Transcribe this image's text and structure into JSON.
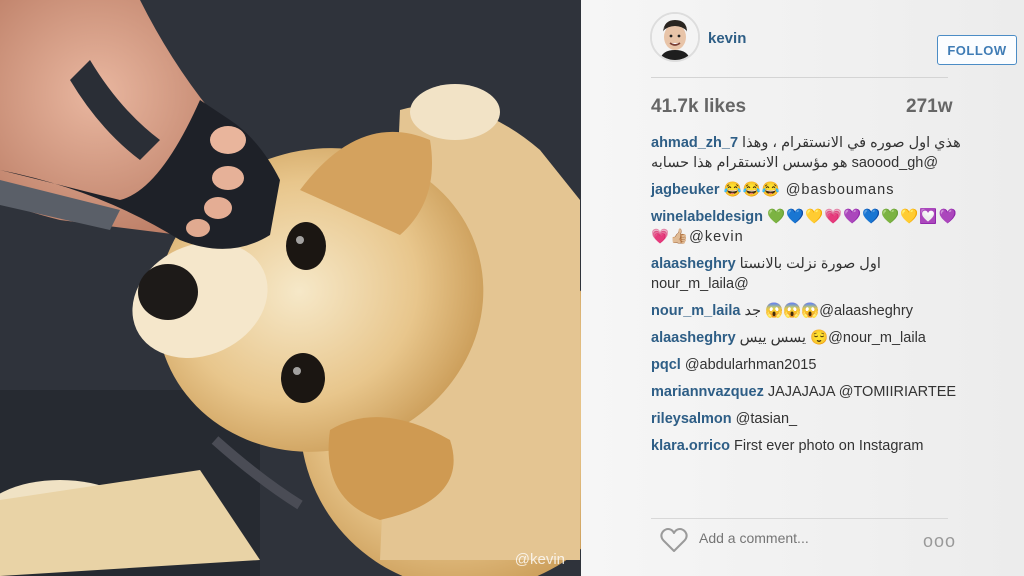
{
  "photo": {
    "watermark": "@kevin"
  },
  "post": {
    "username": "kevin",
    "follow_label": "FOLLOW",
    "likes": "41.7k likes",
    "age": "271w",
    "comments": [
      {
        "user": "ahmad_zh_7",
        "text": "هذي اول صوره في الانستقرام ، وهذا @saoood_gh هو مؤسس الانستقرام هذا حسابه",
        "rtl": true
      },
      {
        "user": "jagbeuker",
        "text": "😂😂😂 @basboumans"
      },
      {
        "user": "winelabeldesign",
        "text": "💚💙💛💗💜💙💚💛💟💜💗👍🏼@kevin"
      },
      {
        "user": "alaasheghry",
        "text": "اول صورة نزلت بالانستا @nour_m_laila",
        "rtl": true
      },
      {
        "user": "nour_m_laila",
        "text": "جد 😱😱😱@alaasheghry"
      },
      {
        "user": "alaasheghry",
        "text": "يسس ييس 😌@nour_m_laila"
      },
      {
        "user": "pqcl",
        "text": "@abdularhman2015"
      },
      {
        "user": "mariannvazquez",
        "text": "JAJAJAJA @TOMIIRIARTEE"
      },
      {
        "user": "rileysalmon",
        "text": "@tasian_"
      },
      {
        "user": "klara.orrico",
        "text": "First ever photo on Instagram"
      }
    ],
    "add_comment_placeholder": "Add a comment...",
    "more_label": "ooo"
  },
  "icons": {
    "heart": "heart-icon",
    "avatar": "profile-photo",
    "more": "more-options-icon"
  },
  "colors": {
    "username": "#2e5e86",
    "follow_border": "#4b8cc5",
    "stats": "#666666",
    "placeholder": "#8a8a8a"
  }
}
